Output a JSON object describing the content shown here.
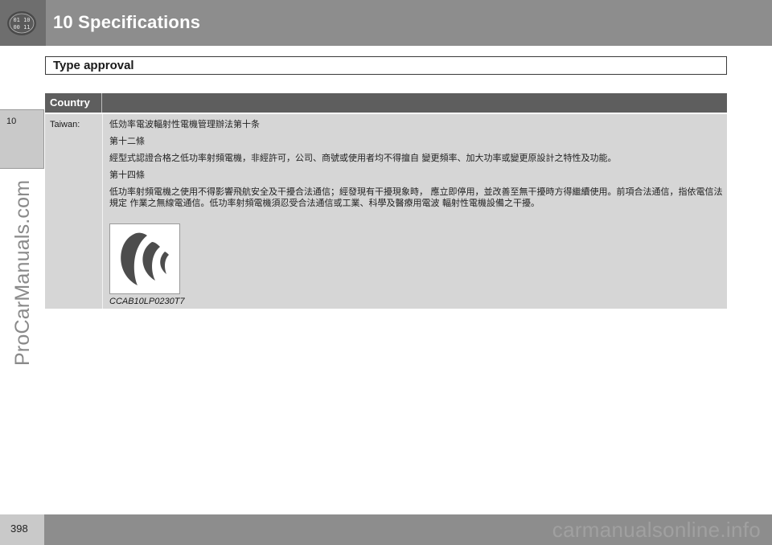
{
  "header": {
    "chapter_title": "10 Specifications",
    "icon_text": [
      "01 10",
      "00 11"
    ]
  },
  "side_tab": {
    "label": "10"
  },
  "section": {
    "heading": "Type approval"
  },
  "table": {
    "header_country": "Country",
    "row": {
      "country": "Taiwan:",
      "lines": [
        "低効率電波輻射性電機管理辦法第十条",
        "第十二條",
        "經型式認證合格之低功率射頻電機，非經許可，公司、商號或使用者均不得擅自  變更頻率、加大功率或變更原設計之特性及功能。",
        "第十四條",
        "低功率射頻電機之使用不得影響飛航安全及干擾合法通信；經發現有干擾現象時，  應立即停用，並改善至無干擾時方得繼續使用。前項合法通信，指依電信法規定  作業之無線電通信。低功率射頻電機須忍受合法通信或工業、科學及醫療用電波  輻射性電機設備之干擾。"
      ],
      "approval_code": "CCAB10LP0230T7"
    }
  },
  "footer": {
    "page_number": "398",
    "watermark": "carmanualsonline.info"
  },
  "watermark_side": "ProCarManuals.com",
  "icons": {
    "approval_mark": "ncc-approval-mark-icon",
    "chapter": "chapter-grid-icon"
  }
}
